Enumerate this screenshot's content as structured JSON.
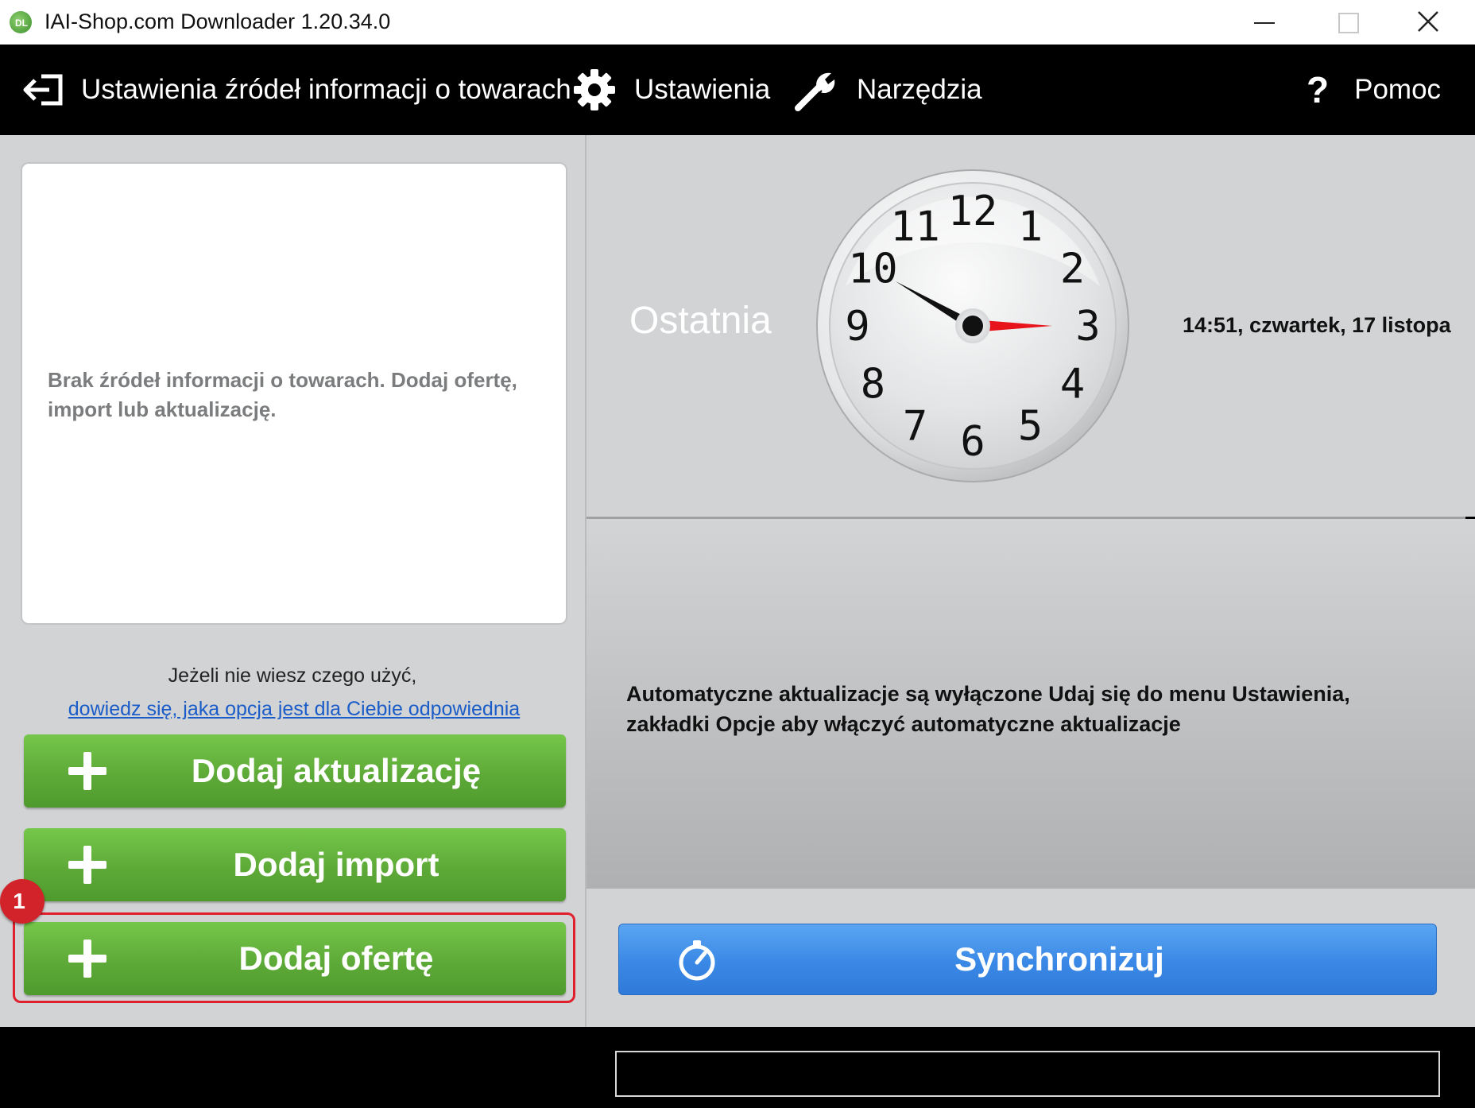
{
  "window": {
    "title": "IAI-Shop.com Downloader 1.20.34.0",
    "app_icon_letters": "DL"
  },
  "menu": {
    "sources_label": "Ustawienia źródeł informacji o towarach",
    "settings_label": "Ustawienia",
    "tools_label": "Narzędzia",
    "help_mark": "?",
    "help_label": "Pomoc"
  },
  "left": {
    "empty_message": "Brak źródeł informacji o towarach. Dodaj ofertę, import lub aktualizację.",
    "hint_text": "Jeżeli nie wiesz czego użyć,",
    "hint_link": "dowiedz się, jaka opcja jest dla Ciebie odpowiednia",
    "buttons": {
      "add_update": "Dodaj aktualizację",
      "add_import": "Dodaj import",
      "add_offer": "Dodaj ofertę"
    },
    "annotation_number": "1"
  },
  "right": {
    "last_label": "Ostatnia",
    "last_time": "14:51, czwartek, 17 listopa",
    "clock": {
      "numbers": [
        "12",
        "1",
        "2",
        "3",
        "4",
        "5",
        "6",
        "7",
        "8",
        "9",
        "10",
        "11"
      ],
      "hour_hand_value": 10,
      "red_hand_value": 15,
      "red_hand_color": "#e8141c"
    },
    "auto_update_message": "Automatyczne aktualizacje są wyłączone Udaj się do menu Ustawienia, zakładki Opcje aby włączyć automatyczne aktualizacje",
    "sync_button": "Synchronizuj"
  },
  "status": {
    "progress": 0
  },
  "colors": {
    "green_button": "#5eaa38",
    "blue_button": "#3a88e6",
    "highlight": "#e0202c",
    "link": "#1a5cc8"
  }
}
